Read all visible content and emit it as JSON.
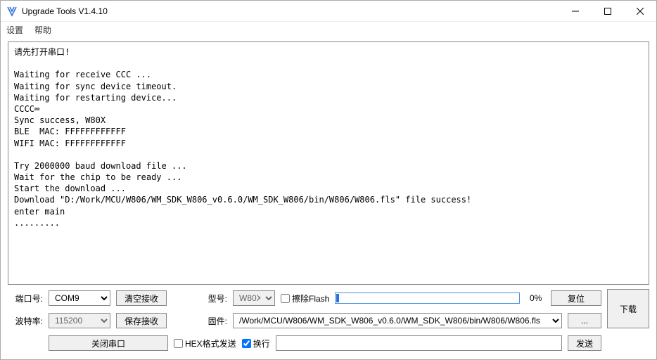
{
  "window": {
    "title": "Upgrade Tools V1.4.10"
  },
  "menu": {
    "settings": "设置",
    "help": "帮助"
  },
  "log": "请先打开串口!\n\nWaiting for receive CCC ...\nWaiting for sync device timeout.\nWaiting for restarting device...\nCCCC═\nSync success, W80X\nBLE  MAC: FFFFFFFFFFFF\nWIFI MAC: FFFFFFFFFFFF\n\nTry 2000000 baud download file ...\nWait for the chip to be ready ...\nStart the download ...\nDownload \"D:/Work/MCU/W806/WM_SDK_W806_v0.6.0/WM_SDK_W806/bin/W806/W806.fls\" file success!\nenter main\n.........",
  "labels": {
    "port": "端口号:",
    "baud": "波特率:",
    "model": "型号:",
    "firmware": "固件:"
  },
  "buttons": {
    "clear_recv": "清空接收",
    "save_recv": "保存接收",
    "close_port": "关闭串口",
    "reset": "复位",
    "browse": "...",
    "download": "下载",
    "send": "发送"
  },
  "fields": {
    "port": "COM9",
    "baud": "115200",
    "model": "W80X",
    "firmware": "/Work/MCU/W806/WM_SDK_W806_v0.6.0/WM_SDK_W806/bin/W806/W806.fls",
    "send_input": ""
  },
  "checkboxes": {
    "erase_flash": "擦除Flash",
    "hex_send": "HEX格式发送",
    "newline": "换行"
  },
  "progress": {
    "percent_text": "0%"
  }
}
